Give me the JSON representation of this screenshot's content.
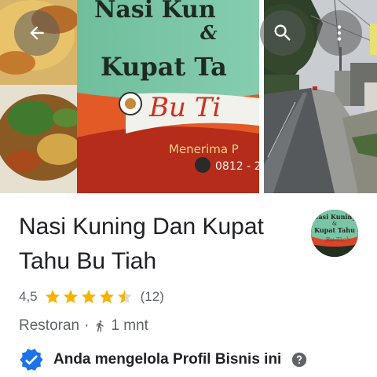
{
  "photos": {
    "banner_line1": "Nasi Kun",
    "banner_amp": "&",
    "banner_line2": "Kupat Ta",
    "banner_line3": "Bu Ti",
    "banner_line4": "Menerima P",
    "banner_phone": "0812 - 2"
  },
  "thumb": {
    "line1": "Nasi Kuning",
    "amp": "&",
    "line2": "Kupat Tahu",
    "line3": "Bu Tiah"
  },
  "place": {
    "name": "Nasi Kuning Dan Kupat Tahu Bu Tiah",
    "rating": "4,5",
    "rating_value": 4.5,
    "review_count": "(12)",
    "category": "Restoran",
    "separator": "·",
    "walk_time": "1 mnt",
    "owner_notice": "Anda mengelola Profil Bisnis ini"
  },
  "icons": {
    "back": "arrow-back-icon",
    "search": "search-icon",
    "more": "more-vert-icon",
    "walk": "walking-icon",
    "verified": "verified-badge-icon",
    "help": "help-icon"
  },
  "colors": {
    "star": "#F5B400",
    "star_empty": "#DADCE0",
    "verified": "#1A73E8",
    "text_primary": "#202124",
    "text_secondary": "#5F6368"
  }
}
